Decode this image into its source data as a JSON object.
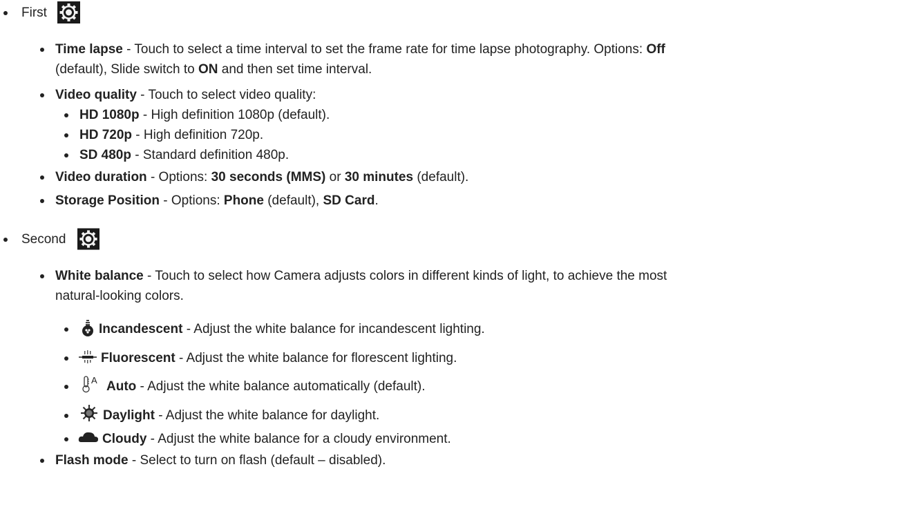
{
  "first": {
    "label": "First",
    "icon": "settings-gear-icon"
  },
  "time_lapse": {
    "name": "Time lapse",
    "desc": " - Touch to select a time interval to set the frame rate for time lapse photography. Options: ",
    "off": "Off",
    "line2_a": "(default), Slide switch to ",
    "on": "ON",
    "line2_b": " and then set time interval."
  },
  "video_quality": {
    "name": "Video quality",
    "desc": " - Touch to select video quality:",
    "options": [
      {
        "name": "HD 1080p",
        "desc": " - High definition 1080p (default)."
      },
      {
        "name": "HD 720p",
        "desc": " - High definition 720p."
      },
      {
        "name": "SD 480p",
        "desc": " - Standard definition 480p."
      }
    ]
  },
  "video_duration": {
    "name": "Video duration",
    "desc": " - Options: ",
    "opt1": "30 seconds (MMS)",
    "or": " or ",
    "opt2": "30 minutes",
    "tail": " (default)."
  },
  "storage": {
    "name": "Storage Position",
    "desc": " - Options: ",
    "opt1": "Phone",
    "mid": " (default), ",
    "opt2": "SD Card",
    "tail": "."
  },
  "second": {
    "label": "Second",
    "icon": "settings-gear-icon"
  },
  "white_balance": {
    "name": "White balance",
    "desc": " - Touch to select how Camera adjusts colors in different kinds of light, to achieve the most",
    "desc2": "natural-looking colors.",
    "options": [
      {
        "icon": "incandescent-bulb-icon",
        "name": "Incandescent",
        "desc": " - Adjust the white balance for incandescent lighting."
      },
      {
        "icon": "fluorescent-tube-icon",
        "name": "Fluorescent",
        "desc": " - Adjust the white balance for florescent lighting."
      },
      {
        "icon": "auto-thermometer-icon",
        "name": "Auto",
        "desc": " - Adjust the white balance automatically (default)."
      },
      {
        "icon": "daylight-sun-icon",
        "name": "Daylight",
        "desc": " - Adjust the white balance for daylight."
      },
      {
        "icon": "cloudy-cloud-icon",
        "name": "Cloudy",
        "desc": " - Adjust the white balance for a cloudy environment."
      }
    ]
  },
  "flash_mode": {
    "name": "Flash mode",
    "desc": " - Select to turn on flash (default – disabled)."
  }
}
